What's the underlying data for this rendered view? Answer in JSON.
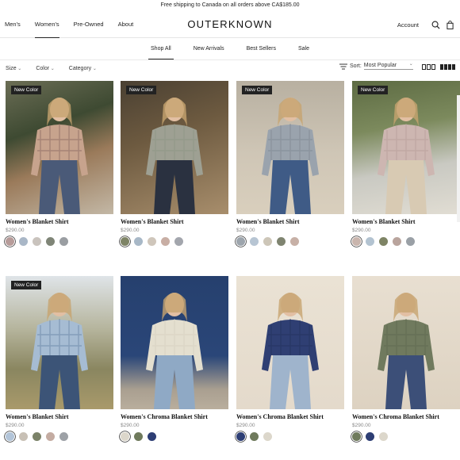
{
  "promo": "Free shipping to Canada on all orders above CA$185.00",
  "brand": "OUTERKNOWN",
  "nav": {
    "left": [
      "Men's",
      "Women's",
      "Pre-Owned",
      "About"
    ],
    "active_index": 1,
    "account": "Account"
  },
  "subnav": {
    "items": [
      "Shop All",
      "New Arrivals",
      "Best Sellers",
      "Sale"
    ],
    "active_index": 0
  },
  "filters": {
    "items": [
      "Size",
      "Color",
      "Category"
    ],
    "sort_label": "Sort:",
    "sort_value": "Most Popular"
  },
  "products": [
    {
      "badge": "New Color",
      "name": "Women's Blanket Shirt",
      "price": "$290.00",
      "swatches": [
        "#b79c9a",
        "#a9b7c7",
        "#c9c3bd",
        "#7f8577",
        "#9a9ea2"
      ],
      "selected": 0,
      "img": "plaid-orange"
    },
    {
      "badge": "New Color",
      "name": "Women's Blanket Shirt",
      "price": "$290.00",
      "swatches": [
        "#7e8466",
        "#a8b8c7",
        "#cfc6bb",
        "#c8aea4",
        "#a3a6ad"
      ],
      "selected": 0,
      "img": "plaid-green"
    },
    {
      "badge": "New Color",
      "name": "Women's Blanket Shirt",
      "price": "$290.00",
      "swatches": [
        "#9da5ad",
        "#b7c5d3",
        "#cdc6b8",
        "#7f8470",
        "#c7b0a6"
      ],
      "selected": 0,
      "img": "plaid-blue"
    },
    {
      "badge": "New Color",
      "name": "Women's Blanket Shirt",
      "price": "$290.00",
      "swatches": [
        "#c9b5ad",
        "#b3c3d1",
        "#7e8465",
        "#b9a49d",
        "#9aa0a6"
      ],
      "selected": 0,
      "img": "plaid-rose"
    },
    {
      "badge": "New Color",
      "name": "Women's Blanket Shirt",
      "price": "$290.00",
      "swatches": [
        "#b2c4d8",
        "#c8c0b5",
        "#7b8268",
        "#c4aca2",
        "#9da1a6"
      ],
      "selected": 0,
      "img": "plaid-lightblue"
    },
    {
      "badge": "",
      "name": "Women's Chroma Blanket Shirt",
      "price": "$290.00",
      "swatches": [
        "#dcd7cb",
        "#6f7a5c",
        "#2d3e74"
      ],
      "selected": 0,
      "img": "cream"
    },
    {
      "badge": "",
      "name": "Women's Chroma Blanket Shirt",
      "price": "$290.00",
      "swatches": [
        "#2d3e74",
        "#6f7a5c",
        "#dcd7cb"
      ],
      "selected": 0,
      "img": "navy"
    },
    {
      "badge": "",
      "name": "Women's Chroma Blanket Shirt",
      "price": "$290.00",
      "swatches": [
        "#6f7a5c",
        "#2d3e74",
        "#dcd7cb"
      ],
      "selected": 0,
      "img": "olive"
    }
  ]
}
